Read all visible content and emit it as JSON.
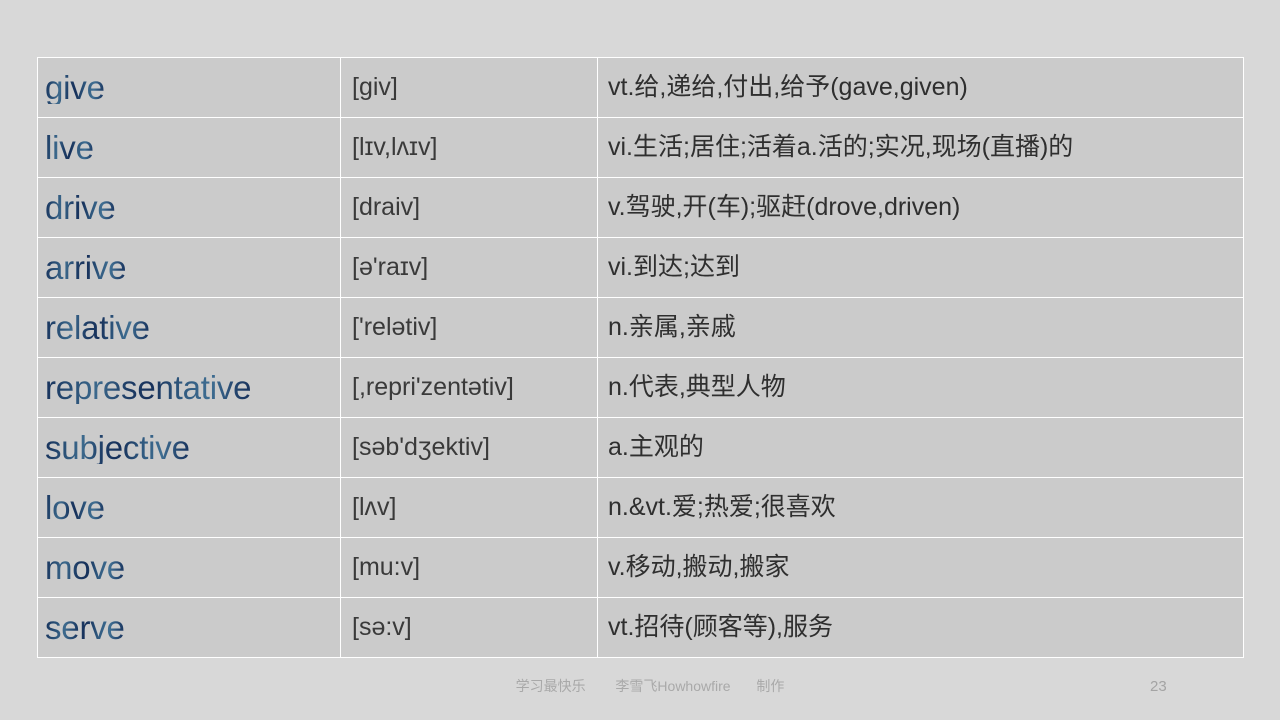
{
  "slide": {
    "background_color": "#d8d8d8",
    "page_number": "23",
    "footer": {
      "left_text": "学习最快乐",
      "middle_text": "李雪飞Howhowfire",
      "right_text": "制作"
    }
  },
  "table": {
    "cell_background": "#cbcbcb",
    "border_color": "#ffffff",
    "word_gradient_dark": "#16305a",
    "word_gradient_light": "#3f6e92",
    "rows": [
      {
        "word": "give",
        "ipa": "[giv]",
        "definition": "vt.给,递给,付出,给予(gave,given)"
      },
      {
        "word": "live",
        "ipa": "[lɪv,lʌɪv]",
        "definition": "vi.生活;居住;活着a.活的;实况,现场(直播)的"
      },
      {
        "word": "drive",
        "ipa": "[draiv]",
        "definition": "v.驾驶,开(车);驱赶(drove,driven)"
      },
      {
        "word": "arrive",
        "ipa": "[ə'raɪv]",
        "definition": "vi.到达;达到"
      },
      {
        "word": "relative",
        "ipa": "['relətiv]",
        "definition": "n.亲属,亲戚"
      },
      {
        "word": "representative",
        "ipa": "[,repri'zentətiv]",
        "definition": "n.代表,典型人物"
      },
      {
        "word": "subjective",
        "ipa": "[səb'dʒektiv]",
        "definition": "a.主观的"
      },
      {
        "word": "love",
        "ipa": "[lʌv]",
        "definition": "n.&vt.爱;热爱;很喜欢"
      },
      {
        "word": "move",
        "ipa": "[mu:v]",
        "definition": "v.移动,搬动,搬家"
      },
      {
        "word": "serve",
        "ipa": "[sə:v]",
        "definition": "vt.招待(顾客等),服务"
      }
    ]
  }
}
